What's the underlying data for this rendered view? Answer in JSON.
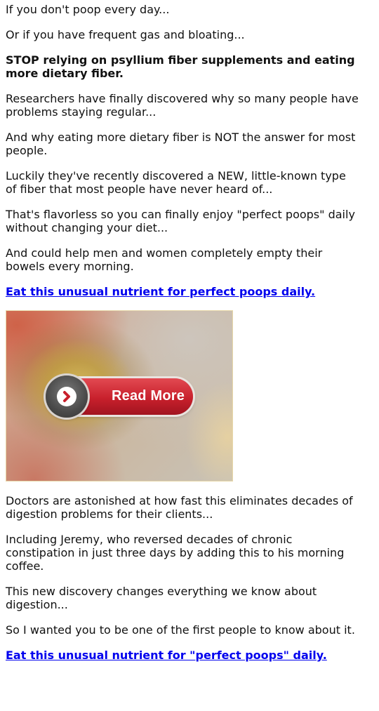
{
  "paragraphs_top": [
    "If you don't poop every day...",
    "Or if you have frequent gas and bloating...",
    "STOP relying on psyllium fiber supplements and eating more dietary fiber.",
    "Researchers have finally discovered why so many people have problems staying regular...",
    "And why eating more dietary fiber is NOT the answer for most people.",
    "Luckily they've recently discovered a NEW, little-known type of fiber that most people have never heard of...",
    "That's flavorless so you can finally enjoy \"perfect poops\" daily without changing your diet...",
    "And could help men and women completely empty their bowels every morning."
  ],
  "link_top": "Eat this unusual nutrient for perfect poops daily.",
  "hero": {
    "button_label": "Read More",
    "button_icon": "chevron-right-icon",
    "button_color": "#c8202c"
  },
  "paragraphs_bottom": [
    "Doctors are astonished at how fast this eliminates decades of digestion problems for their clients...",
    "Including Jeremy, who reversed decades of chronic constipation in just three days by adding this to his morning coffee.",
    "This new discovery changes everything we know about digestion...",
    "So I wanted you to be one of the first people to know about it."
  ],
  "link_bottom": "Eat this unusual nutrient for \"perfect poops\" daily.",
  "colors": {
    "link": "#0000ee",
    "text": "#111111"
  }
}
